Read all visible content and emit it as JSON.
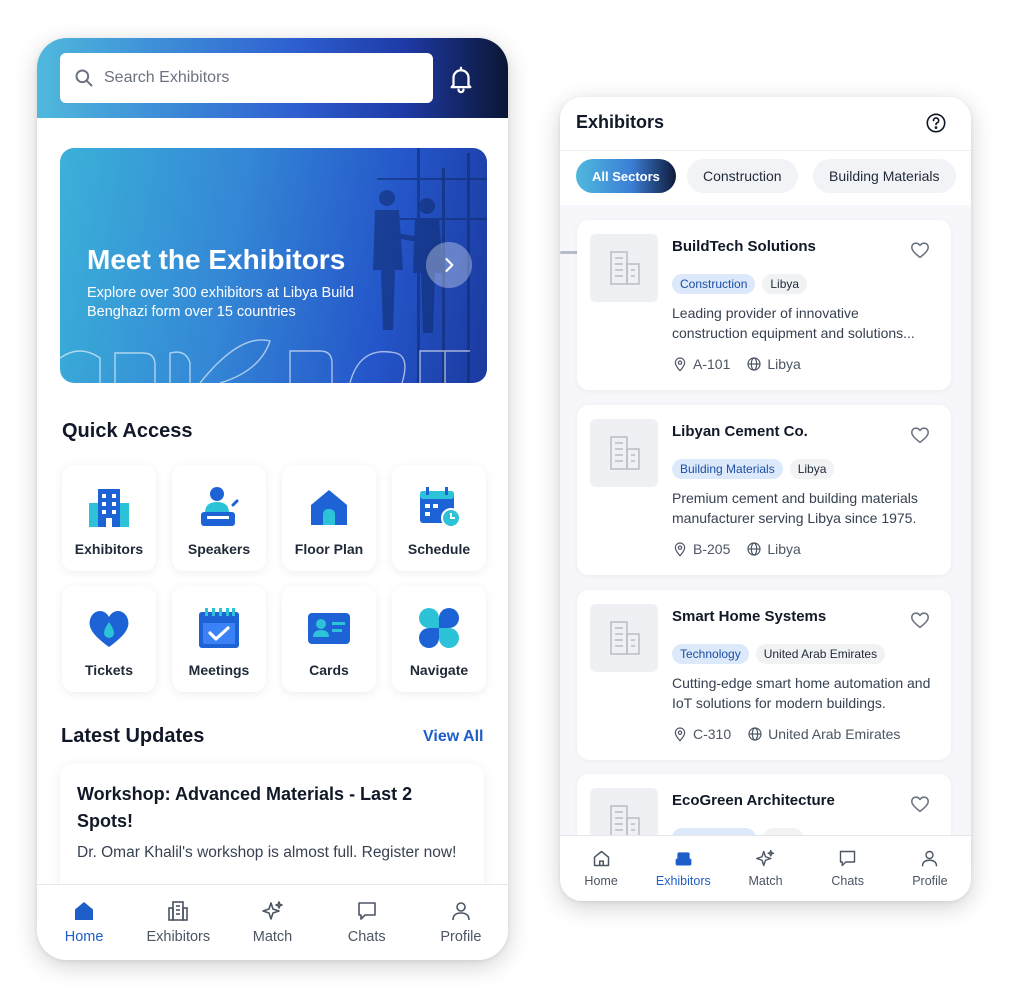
{
  "home": {
    "search_placeholder": "Search Exhibitors",
    "banner": {
      "title": "Meet the Exhibitors",
      "subtitle": "Explore over 300 exhibitors at Libya Build Benghazi form over 15 countries"
    },
    "quick_access_title": "Quick Access",
    "quick_access": [
      {
        "label": "Exhibitors",
        "icon": "building-icon"
      },
      {
        "label": "Speakers",
        "icon": "speaker-icon"
      },
      {
        "label": "Floor Plan",
        "icon": "house-icon"
      },
      {
        "label": "Schedule",
        "icon": "calendar-clock-icon"
      },
      {
        "label": "Tickets",
        "icon": "heart-ticket-icon"
      },
      {
        "label": "Meetings",
        "icon": "calendar-check-icon"
      },
      {
        "label": "Cards",
        "icon": "id-card-icon"
      },
      {
        "label": "Navigate",
        "icon": "clover-icon"
      }
    ],
    "latest_updates_title": "Latest Updates",
    "view_all": "View All",
    "update": {
      "title": "Workshop: Advanced Materials - Last 2 Spots!",
      "body": "Dr. Omar Khalil's workshop is almost full. Register now!"
    },
    "nav": [
      {
        "label": "Home",
        "icon": "home-icon",
        "active": true
      },
      {
        "label": "Exhibitors",
        "icon": "building-icon",
        "active": false
      },
      {
        "label": "Match",
        "icon": "sparkle-icon",
        "active": false
      },
      {
        "label": "Chats",
        "icon": "chat-icon",
        "active": false
      },
      {
        "label": "Profile",
        "icon": "user-icon",
        "active": false
      }
    ]
  },
  "exhibitors": {
    "title": "Exhibitors",
    "sectors": [
      "All Sectors",
      "Construction",
      "Building Materials"
    ],
    "items": [
      {
        "name": "BuildTech Solutions",
        "sector": "Construction",
        "country": "Libya",
        "description": "Leading provider of innovative construction equipment and solutions...",
        "booth": "A-101",
        "location": "Libya"
      },
      {
        "name": "Libyan Cement Co.",
        "sector": "Building Materials",
        "country": "Libya",
        "description": "Premium cement and building materials manufacturer serving Libya since 1975.",
        "booth": "B-205",
        "location": "Libya"
      },
      {
        "name": "Smart Home Systems",
        "sector": "Technology",
        "country": "United Arab Emirates",
        "description": "Cutting-edge smart home automation and IoT solutions for modern buildings.",
        "booth": "C-310",
        "location": "United Arab Emirates"
      },
      {
        "name": "EcoGreen Architecture",
        "sector": "",
        "country": "",
        "description": "",
        "booth": "",
        "location": ""
      }
    ],
    "nav": [
      {
        "label": "Home",
        "icon": "home-icon",
        "active": false
      },
      {
        "label": "Exhibitors",
        "icon": "building-icon",
        "active": true
      },
      {
        "label": "Match",
        "icon": "sparkle-icon",
        "active": false
      },
      {
        "label": "Chats",
        "icon": "chat-icon",
        "active": false
      },
      {
        "label": "Profile",
        "icon": "user-icon",
        "active": false
      }
    ]
  },
  "colors": {
    "accent": "#1e5ec8",
    "gradient_start": "#4fb9dc",
    "gradient_end": "#0b1634",
    "tag_sector_bg": "#dce9fb",
    "tag_sector_text": "#1d4fa3"
  }
}
